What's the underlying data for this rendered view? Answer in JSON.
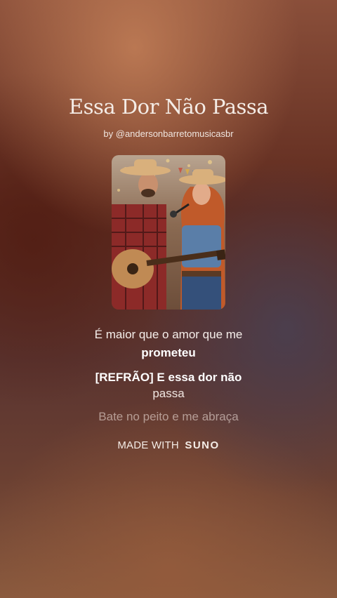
{
  "song": {
    "title": "Essa Dor Não Passa",
    "byline": "by @andersonbarretomusicasbr"
  },
  "cover": {
    "icon": "album-cover-image"
  },
  "lyrics": {
    "line1_a": "É maior que o amor que me",
    "line1_b": "prometeu",
    "line2_a": "[REFRÃO] E essa dor não",
    "line2_b": "passa",
    "line3": "Bate no peito e me abraça"
  },
  "footer": {
    "prefix": "MADE WITH",
    "brand": "SUNO"
  }
}
